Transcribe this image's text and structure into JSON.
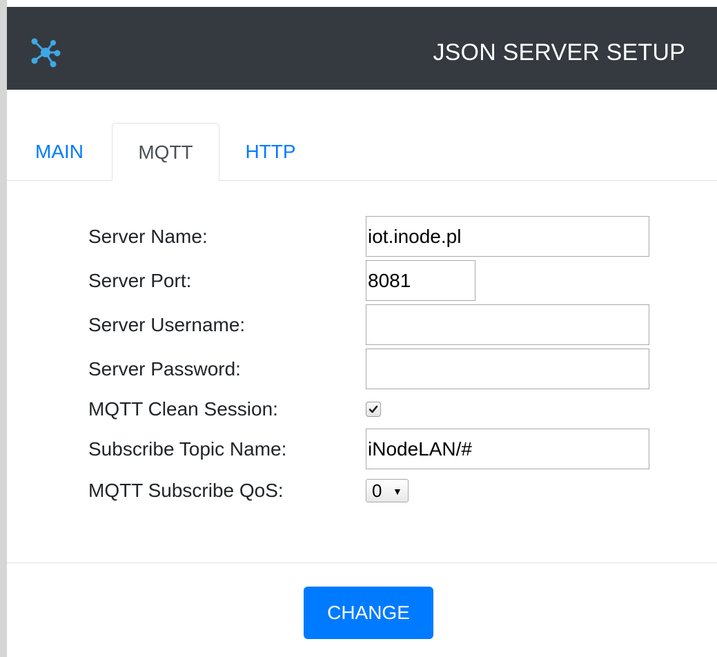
{
  "header": {
    "title": "JSON SERVER SETUP",
    "logo_icon": "network-hub-icon",
    "background_color": "#343a40",
    "logo_color": "#3ea8e6"
  },
  "tabs": [
    {
      "label": "MAIN",
      "active": false
    },
    {
      "label": "MQTT",
      "active": true
    },
    {
      "label": "HTTP",
      "active": false
    }
  ],
  "form": {
    "server_name": {
      "label": "Server Name:",
      "value": "iot.inode.pl"
    },
    "server_port": {
      "label": "Server Port:",
      "value": "8081"
    },
    "server_username": {
      "label": "Server Username:",
      "value": ""
    },
    "server_password": {
      "label": "Server Password:",
      "value": ""
    },
    "clean_session": {
      "label": "MQTT Clean Session:",
      "checked": true
    },
    "subscribe_topic": {
      "label": "Subscribe Topic Name:",
      "value": "iNodeLAN/#"
    },
    "subscribe_qos": {
      "label": "MQTT Subscribe QoS:",
      "selected": "0"
    }
  },
  "actions": {
    "change_label": "CHANGE",
    "button_color": "#007bff"
  },
  "colors": {
    "link": "#007bff",
    "active_tab_text": "#495057"
  }
}
